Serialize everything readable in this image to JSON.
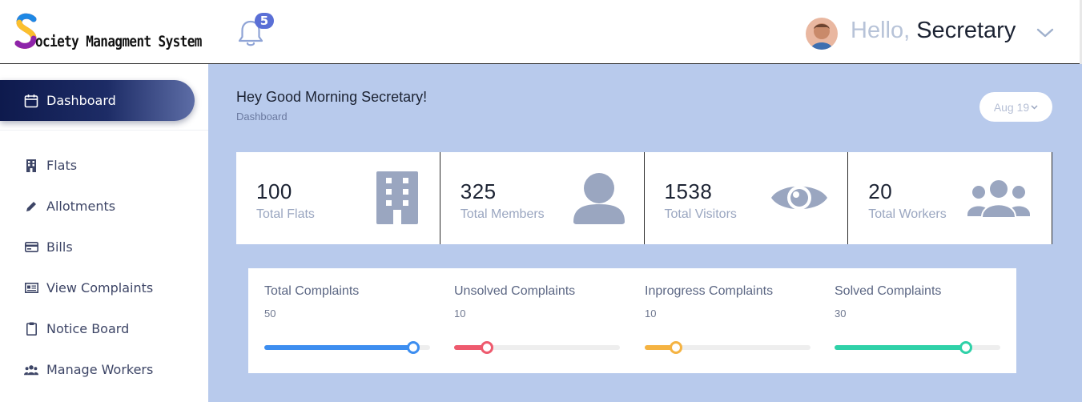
{
  "app": {
    "logo_text": "ociety Managment System"
  },
  "sidebar": {
    "active": {
      "label": "Dashboard",
      "icon": "calendar-icon"
    },
    "items": [
      {
        "label": "Flats",
        "icon": "building-icon"
      },
      {
        "label": "Allotments",
        "icon": "pencil-icon"
      },
      {
        "label": "Bills",
        "icon": "credit-card-icon"
      },
      {
        "label": "View Complaints",
        "icon": "newspaper-icon"
      },
      {
        "label": "Notice Board",
        "icon": "clipboard-icon"
      },
      {
        "label": "Manage Workers",
        "icon": "users-icon"
      }
    ]
  },
  "header": {
    "notifications_count": "5",
    "greeting": "Hello,",
    "user_name": "Secretary"
  },
  "main": {
    "greeting": "Hey Good Morning Secretary!",
    "breadcrumb": "Dashboard",
    "date_filter": "Aug 19"
  },
  "stats": [
    {
      "value": "100",
      "label": "Total Flats",
      "icon": "building-icon"
    },
    {
      "value": "325",
      "label": "Total Members",
      "icon": "user-icon"
    },
    {
      "value": "1538",
      "label": "Total Visitors",
      "icon": "eye-icon"
    },
    {
      "value": "20",
      "label": "Total Workers",
      "icon": "users-icon"
    }
  ],
  "complaints": [
    {
      "label": "Total Complaints",
      "value": "50",
      "fraction": 0.9,
      "color": "#3d8ef0"
    },
    {
      "label": "Unsolved Complaints",
      "value": "10",
      "fraction": 0.2,
      "color": "#ee5a6e"
    },
    {
      "label": "Inprogress Complaints",
      "value": "10",
      "fraction": 0.19,
      "color": "#f5b342"
    },
    {
      "label": "Solved Complaints",
      "value": "30",
      "fraction": 0.79,
      "color": "#2fd1a8"
    }
  ],
  "colors": {
    "sidebar_active": "#0e1a4d",
    "main_bg": "#b8caec",
    "stat_icon": "#9aa6c0"
  }
}
